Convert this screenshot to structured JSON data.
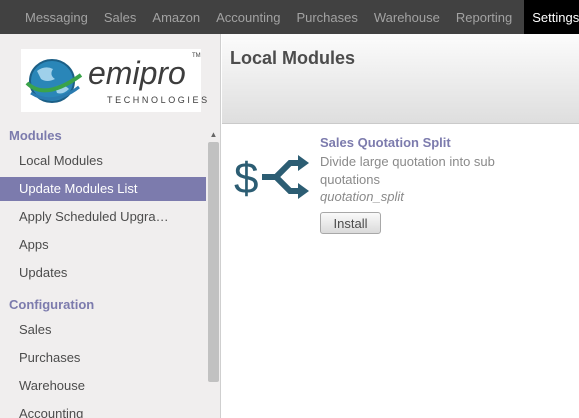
{
  "top_menu": {
    "items": [
      {
        "label": "Messaging"
      },
      {
        "label": "Sales"
      },
      {
        "label": "Amazon"
      },
      {
        "label": "Accounting"
      },
      {
        "label": "Purchases"
      },
      {
        "label": "Warehouse"
      },
      {
        "label": "Reporting"
      }
    ],
    "active": {
      "label": "Settings"
    }
  },
  "logo": {
    "wordmark": "emipro",
    "subtitle": "TECHNOLOGIES",
    "trademark": "TM"
  },
  "sidebar": {
    "sections": [
      {
        "title": "Modules",
        "items": [
          {
            "label": "Local Modules"
          },
          {
            "label": "Update Modules List",
            "selected": true
          },
          {
            "label": "Apply Scheduled Upgra…"
          },
          {
            "label": "Apps"
          },
          {
            "label": "Updates"
          }
        ]
      },
      {
        "title": "Configuration",
        "items": [
          {
            "label": "Sales"
          },
          {
            "label": "Purchases"
          },
          {
            "label": "Warehouse"
          },
          {
            "label": "Accounting"
          }
        ]
      }
    ]
  },
  "page": {
    "title": "Local Modules"
  },
  "module": {
    "name": "Sales Quotation Split",
    "description": "Divide large quotation into sub quotations",
    "technical_name": "quotation_split",
    "install_label": "Install",
    "icon": "dollar-split-icon",
    "icon_color": "#2c5d73"
  },
  "colors": {
    "accent": "#7c7bad",
    "topbar": "#414141",
    "topbar_active": "#000000"
  }
}
